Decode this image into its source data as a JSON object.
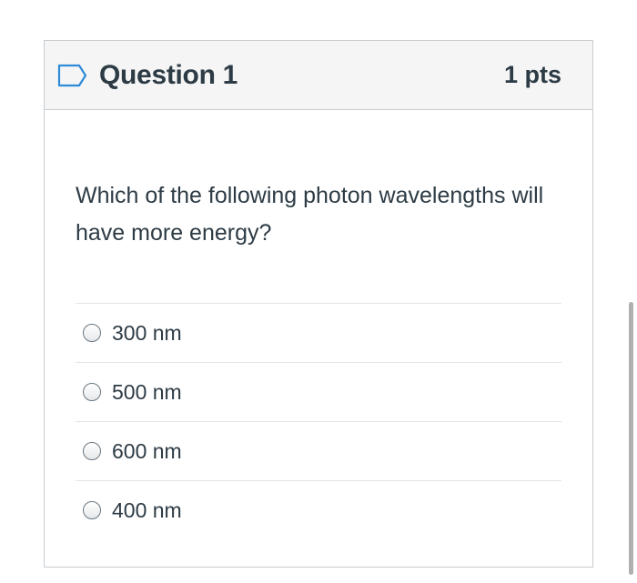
{
  "question": {
    "title": "Question 1",
    "points": "1 pts",
    "text": "Which of the following photon wavelengths will have more energy?",
    "flag_icon": "flag-outline-icon"
  },
  "answers": [
    {
      "label": "300 nm",
      "selected": false
    },
    {
      "label": "500 nm",
      "selected": false
    },
    {
      "label": "600 nm",
      "selected": false
    },
    {
      "label": "400 nm",
      "selected": false
    }
  ],
  "colors": {
    "text": "#2d3b45",
    "header_bg": "#f5f5f5",
    "border": "#c7cdd1",
    "flag": "#2d8bd8"
  }
}
